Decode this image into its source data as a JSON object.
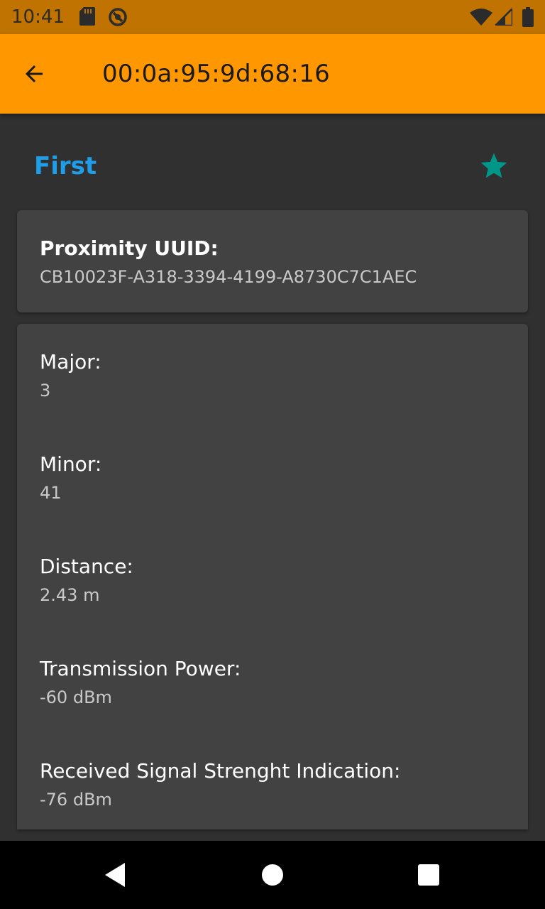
{
  "status_bar": {
    "time": "10:41",
    "icons_left": [
      "sd-card-icon",
      "vpn-icon"
    ],
    "icons_right": [
      "wifi-icon",
      "cell-signal-icon",
      "battery-icon"
    ],
    "color": "#c07300"
  },
  "app_bar": {
    "title": "00:0a:95:9d:68:16",
    "back_icon": "arrow-back-icon",
    "color": "#ff9800"
  },
  "beacon": {
    "name": "First",
    "name_color": "#1e9ee8",
    "favorite_icon": "star-icon",
    "favorite_color": "#009688",
    "favorited": true
  },
  "uuid_card": {
    "label": "Proximity UUID:",
    "value": "CB10023F-A318-3394-4199-A8730C7C1AEC"
  },
  "details": {
    "major": {
      "label": "Major:",
      "value": "3"
    },
    "minor": {
      "label": "Minor:",
      "value": "41"
    },
    "distance": {
      "label": "Distance:",
      "value": "2.43 m"
    },
    "tx_power": {
      "label": "Transmission Power:",
      "value": "-60 dBm"
    },
    "rssi": {
      "label": "Received Signal Strenght Indication:",
      "value": "-76 dBm"
    }
  },
  "nav_bar": {
    "back_icon": "nav-back-icon",
    "home_icon": "nav-home-icon",
    "recents_icon": "nav-recents-icon"
  },
  "theme": {
    "background": "#303030",
    "card": "#424242"
  }
}
